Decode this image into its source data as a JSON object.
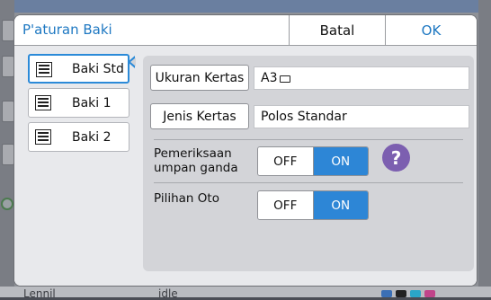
{
  "dialog": {
    "title": "P'aturan Baki",
    "cancel_label": "Batal",
    "ok_label": "OK"
  },
  "trays": [
    {
      "label": "Baki Std",
      "selected": true
    },
    {
      "label": "Baki 1",
      "selected": false
    },
    {
      "label": "Baki 2",
      "selected": false
    }
  ],
  "settings": {
    "paper_size": {
      "button_label": "Ukuran Kertas",
      "value": "A3"
    },
    "paper_type": {
      "button_label": "Jenis Kertas",
      "value": "Polos Standar"
    },
    "double_feed": {
      "label_line1": "Pemeriksaan",
      "label_line2": "umpan ganda",
      "off_label": "OFF",
      "on_label": "ON",
      "state": "ON",
      "help_label": "?"
    },
    "auto_select": {
      "label": "Pilihan Oto",
      "off_label": "OFF",
      "on_label": "ON",
      "state": "ON"
    }
  },
  "background": {
    "bottom_left_text": "Lennil",
    "bottom_mid_text": "idle"
  },
  "colors": {
    "accent": "#1e78c2",
    "on_state": "#2d86d6",
    "help": "#7c5fb0",
    "panel": "#d3d4d8"
  }
}
